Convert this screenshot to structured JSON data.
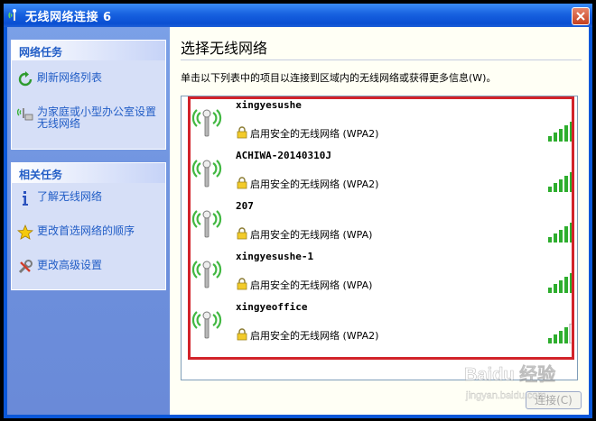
{
  "window": {
    "title": "无线网络连接 6"
  },
  "sidebar": {
    "network_tasks": {
      "header": "网络任务",
      "items": [
        {
          "label": "刷新网络列表",
          "icon": "refresh-icon"
        },
        {
          "label": "为家庭或小型办公室设置无线网络",
          "icon": "setup-wireless-icon"
        }
      ]
    },
    "related_tasks": {
      "header": "相关任务",
      "items": [
        {
          "label": "了解无线网络",
          "icon": "info-icon"
        },
        {
          "label": "更改首选网络的顺序",
          "icon": "star-icon"
        },
        {
          "label": "更改高级设置",
          "icon": "tools-icon"
        }
      ]
    }
  },
  "main": {
    "title": "选择无线网络",
    "instructions": "单击以下列表中的项目以连接到区域内的无线网络或获得更多信息(W)。",
    "networks": [
      {
        "ssid": "xingyesushe",
        "security": "启用安全的无线网络 (WPA2)",
        "signal_bars": 5
      },
      {
        "ssid": "ACHIWA-20140310J",
        "security": "启用安全的无线网络 (WPA2)",
        "signal_bars": 5
      },
      {
        "ssid": "207",
        "security": "启用安全的无线网络 (WPA)",
        "signal_bars": 5
      },
      {
        "ssid": "xingyesushe-1",
        "security": "启用安全的无线网络 (WPA)",
        "signal_bars": 5
      },
      {
        "ssid": "xingyeoffice",
        "security": "启用安全的无线网络 (WPA2)",
        "signal_bars": 4
      }
    ],
    "connect_label": "连接(C)"
  },
  "watermark": {
    "text": "Baidu 经验",
    "subtext": "jingyan.baidu.com"
  },
  "colors": {
    "title_bar": "#0a57d8",
    "sidebar_bg": "#6c8fdc",
    "task_link": "#215dc6",
    "highlight_border": "#d2232a",
    "signal_green": "#2eae2e"
  }
}
